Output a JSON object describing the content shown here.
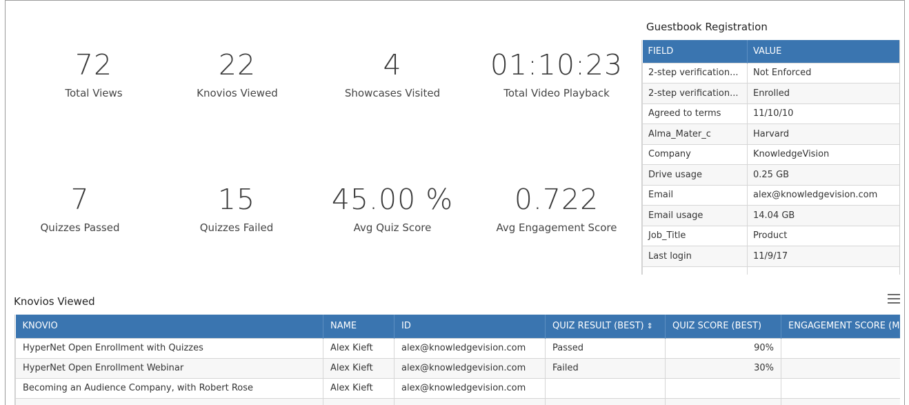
{
  "stats": [
    {
      "value": "72",
      "label": "Total Views"
    },
    {
      "value": "22",
      "label": "Knovios Viewed"
    },
    {
      "value": "4",
      "label": "Showcases Visited"
    },
    {
      "value": "01:10:23",
      "label": "Total Video Playback"
    },
    {
      "value": "7",
      "label": "Quizzes Passed"
    },
    {
      "value": "15",
      "label": "Quizzes Failed"
    },
    {
      "value": "45.00 %",
      "label": "Avg Quiz Score"
    },
    {
      "value": "0.722",
      "label": "Avg Engagement Score"
    }
  ],
  "guestbook": {
    "title": "Guestbook Registration",
    "headers": [
      "FIELD",
      "VALUE"
    ],
    "rows": [
      [
        "2-step verification...",
        "Not Enforced"
      ],
      [
        "2-step verification...",
        "Enrolled"
      ],
      [
        "Agreed to terms",
        "11/10/10"
      ],
      [
        "Alma_Mater_c",
        "Harvard"
      ],
      [
        "Company",
        "KnowledgeVision"
      ],
      [
        "Drive usage",
        "0.25 GB"
      ],
      [
        "Email",
        "alex@knowledgevision.com"
      ],
      [
        "Email usage",
        "14.04 GB"
      ],
      [
        "Job_Title",
        "Product"
      ],
      [
        "Last login",
        "11/9/17"
      ],
      [
        "",
        ""
      ]
    ]
  },
  "knovios": {
    "title": "Knovios Viewed",
    "menu_icon": "hamburger-menu-icon",
    "headers": [
      "KNOVIO",
      "NAME",
      "ID",
      "QUIZ RESULT (BEST)",
      "QUIZ SCORE (BEST)",
      "ENGAGEMENT SCORE (M"
    ],
    "sort_glyph": "⇕",
    "rows": [
      [
        "HyperNet Open Enrollment with Quizzes",
        "Alex Kieft",
        "alex@knowledgevision.com",
        "Passed",
        "90%",
        ""
      ],
      [
        "HyperNet Open Enrollment Webinar",
        "Alex Kieft",
        "alex@knowledgevision.com",
        "Failed",
        "30%",
        ""
      ],
      [
        "Becoming an Audience Company, with Robert Rose",
        "Alex Kieft",
        "alex@knowledgevision.com",
        "",
        "",
        ""
      ],
      [
        "",
        "",
        "",
        "",
        "",
        ""
      ]
    ]
  },
  "colors": {
    "header_blue": "#3a75b0"
  }
}
